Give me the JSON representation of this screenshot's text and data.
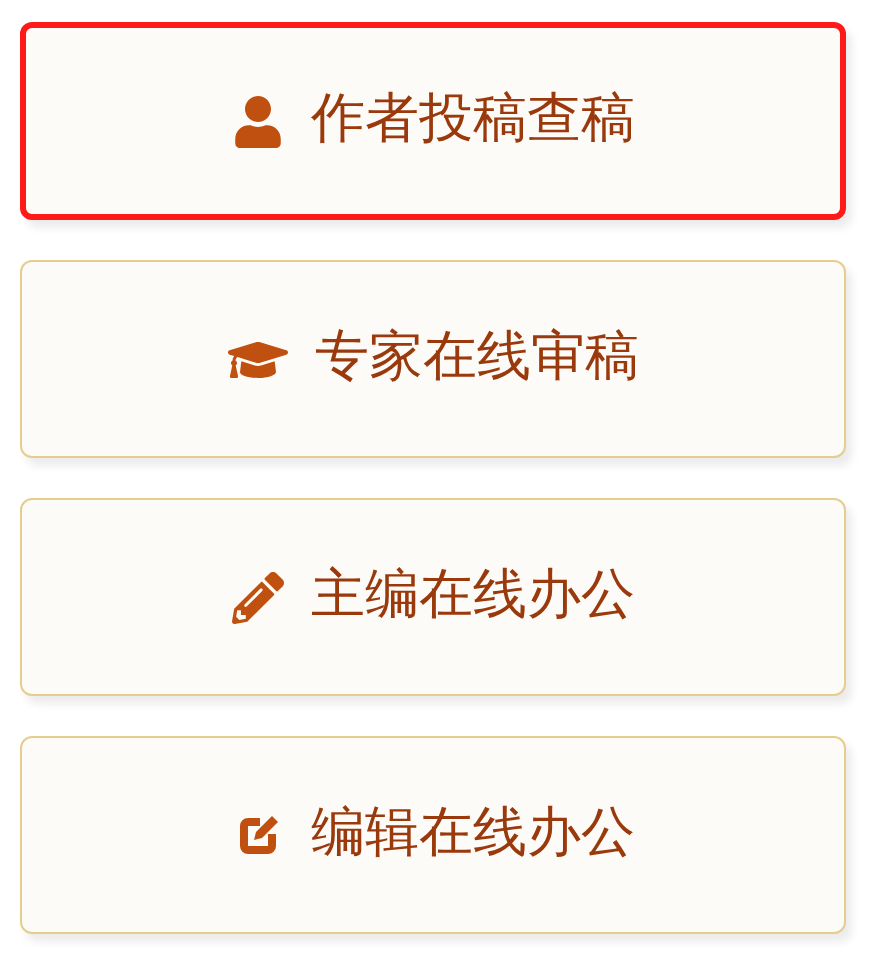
{
  "buttons": [
    {
      "label": "作者投稿查稿",
      "selected": true
    },
    {
      "label": "专家在线审稿",
      "selected": false
    },
    {
      "label": "主编在线办公",
      "selected": false
    },
    {
      "label": "编辑在线办公",
      "selected": false
    }
  ]
}
